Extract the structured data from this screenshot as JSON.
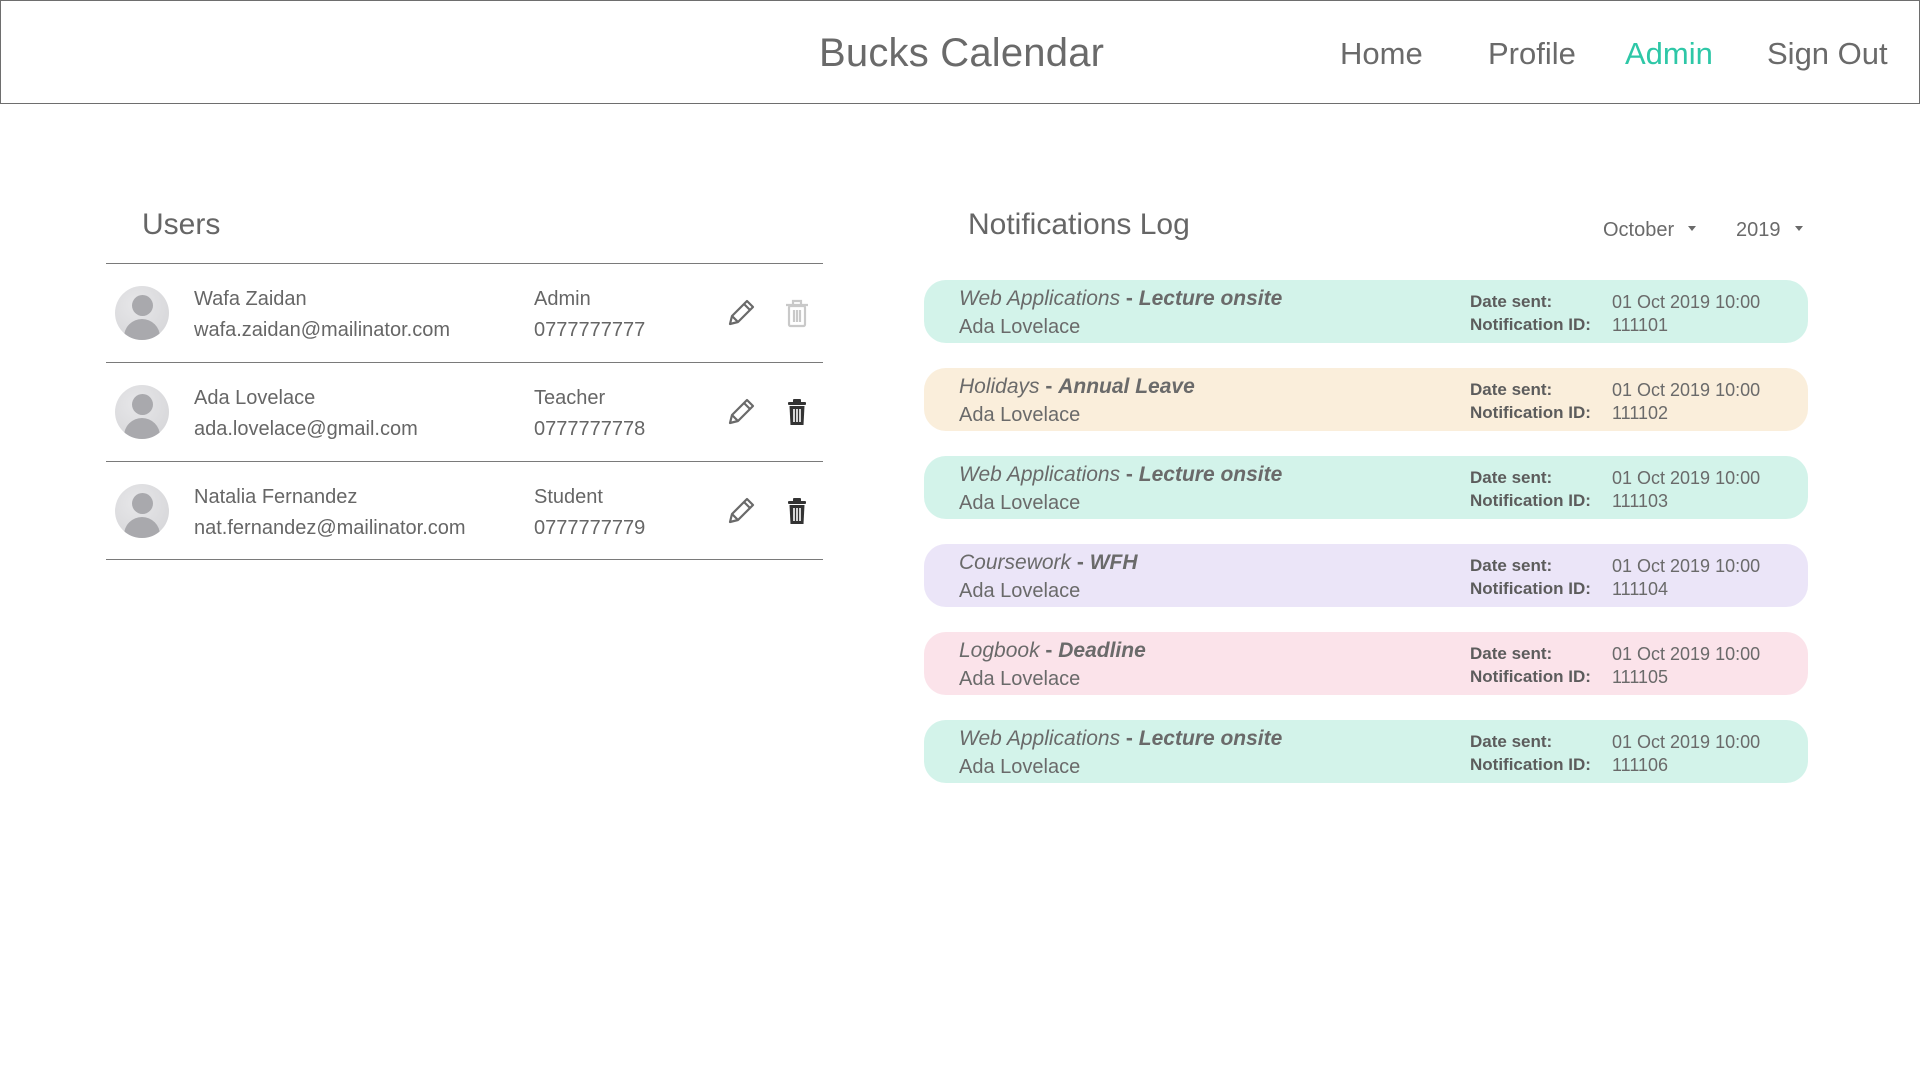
{
  "header": {
    "title": "Bucks Calendar",
    "nav": {
      "home": "Home",
      "profile": "Profile",
      "admin": "Admin",
      "sign_out": "Sign Out"
    },
    "active_color": "#2ec7a7"
  },
  "users": {
    "title": "Users",
    "rows": [
      {
        "name": "Wafa Zaidan",
        "email": "wafa.zaidan@mailinator.com",
        "role": "Admin",
        "phone": "0777777777",
        "delete_enabled": false
      },
      {
        "name": "Ada Lovelace",
        "email": "ada.lovelace@gmail.com",
        "role": "Teacher",
        "phone": "0777777778",
        "delete_enabled": true
      },
      {
        "name": "Natalia Fernandez",
        "email": "nat.fernandez@mailinator.com",
        "role": "Student",
        "phone": "0777777779",
        "delete_enabled": true
      }
    ]
  },
  "notifications": {
    "title": "Notifications Log",
    "month": "October",
    "year": "2019",
    "date_label": "Date sent:",
    "id_label": "Notification ID:",
    "items": [
      {
        "course": "Web Applications",
        "type": "Lecture onsite",
        "teacher": "Ada Lovelace",
        "date": "01 Oct 2019 10:00",
        "id": "111101",
        "color": "#d3f3ea"
      },
      {
        "course": "Holidays",
        "type": "Annual Leave",
        "teacher": "Ada Lovelace",
        "date": "01 Oct 2019 10:00",
        "id": "111102",
        "color": "#faeedb"
      },
      {
        "course": "Web Applications",
        "type": "Lecture onsite",
        "teacher": "Ada Lovelace",
        "date": "01 Oct 2019 10:00",
        "id": "111103",
        "color": "#d3f3ea"
      },
      {
        "course": "Coursework",
        "type": "WFH",
        "teacher": "Ada Lovelace",
        "date": "01 Oct 2019 10:00",
        "id": "111104",
        "color": "#ebe5f8"
      },
      {
        "course": "Logbook",
        "type": "Deadline",
        "teacher": "Ada Lovelace",
        "date": "01 Oct 2019 10:00",
        "id": "111105",
        "color": "#fbe3ea"
      },
      {
        "course": "Web Applications",
        "type": "Lecture onsite",
        "teacher": "Ada Lovelace",
        "date": "01 Oct 2019 10:00",
        "id": "111106",
        "color": "#d3f3ea"
      }
    ]
  },
  "icons": {
    "edit": "pencil-icon",
    "delete": "trash-icon",
    "avatar": "user-avatar-icon",
    "dropdown": "chevron-down-icon"
  }
}
